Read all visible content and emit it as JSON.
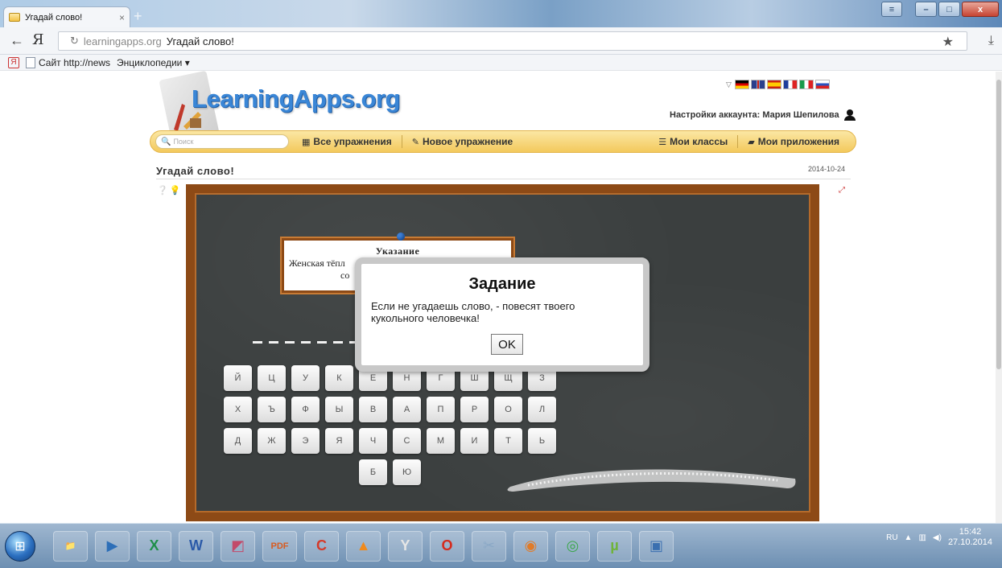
{
  "browser": {
    "tab_title": "Угадай слово!",
    "tab_close": "×",
    "new_tab": "+",
    "nav_back": "←",
    "nav_brand": "Я",
    "reload": "↻",
    "url_host": "learningapps.org",
    "url_title": "Угадай слово!",
    "star": "★",
    "download": "⤓",
    "window_buttons": {
      "menu": "≡",
      "minimize": "–",
      "maximize": "□",
      "close": "x"
    }
  },
  "bookmarks": {
    "yandex": "Я",
    "items": [
      "Сайт http://news",
      "Энциклопедии ▾"
    ]
  },
  "site": {
    "logo": "LearningApps.org",
    "account_label": "Настройки аккаунта: Мария Шепилова",
    "search_placeholder": "Поиск",
    "menu": {
      "all_exercises": "Все упражнения",
      "new_exercise": "Новое упражнение",
      "my_classes": "Мои классы",
      "my_apps": "Мои приложения"
    },
    "exercise_title": "Угадай слово!",
    "exercise_date": "2014-10-24"
  },
  "game": {
    "hint_title": "Указание",
    "hint_text_line1": "Женская тёпл",
    "hint_text_line2": "со",
    "word_slot_count": 8,
    "keyboard_rows": [
      [
        "Й",
        "Ц",
        "У",
        "К",
        "Е",
        "Н",
        "Г",
        "Ш",
        "Щ",
        "З"
      ],
      [
        "Х",
        "Ъ",
        "Ф",
        "Ы",
        "В",
        "А",
        "П",
        "Р",
        "О",
        "Л"
      ],
      [
        "Д",
        "Ж",
        "Э",
        "Я",
        "Ч",
        "С",
        "М",
        "И",
        "Т",
        "Ь"
      ],
      [
        "Б",
        "Ю"
      ]
    ]
  },
  "modal": {
    "title": "Задание",
    "text": "Если не угадаешь слово, - повесят твоего кукольного человечка!",
    "ok_label": "OK"
  },
  "taskbar": {
    "apps": [
      "explorer",
      "media-player",
      "excel",
      "word",
      "photo-viewer",
      "pdf",
      "ccleaner",
      "vlc",
      "yandex-browser",
      "opera",
      "paint",
      "firefox",
      "chrome",
      "utorrent",
      "picture-manager"
    ],
    "app_glyphs": [
      "📁",
      "▶",
      "X",
      "W",
      "◩",
      "PDF",
      "C",
      "▲",
      "Y",
      "O",
      "✂",
      "◉",
      "◎",
      "µ",
      "▣"
    ],
    "lang": "RU",
    "time": "15:42",
    "date": "27.10.2014"
  },
  "colors": {
    "board": "#3b3f3f",
    "frame": "#8d4a16",
    "menubar": "#f3c95c",
    "logo": "#3a86d6"
  }
}
